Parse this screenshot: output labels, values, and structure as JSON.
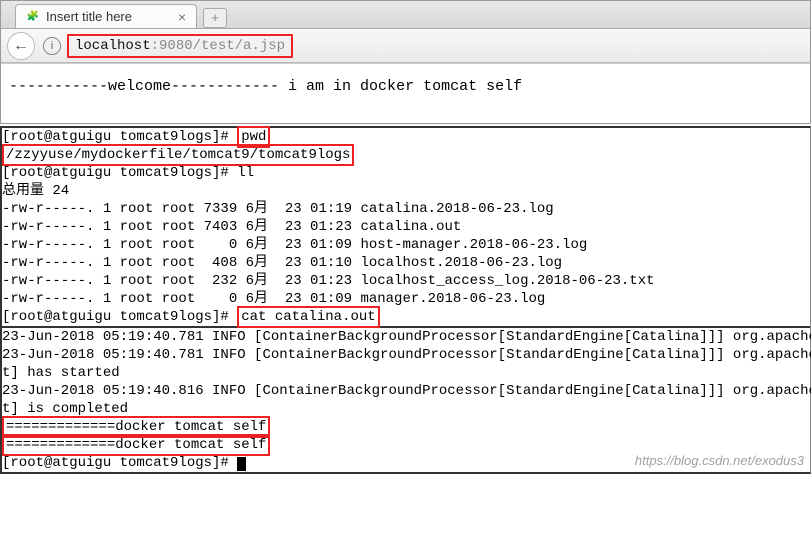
{
  "browser": {
    "tab_title": "Insert title here",
    "favicon_glyph": "🧩",
    "close_glyph": "×",
    "newtab_glyph": "+",
    "back_glyph": "←",
    "info_glyph": "i",
    "url_host": "localhost",
    "url_path": ":9080/test/a.jsp",
    "page_body": "-----------welcome------------ i am in docker tomcat self"
  },
  "terminal": {
    "prompt1": "[root@atguigu tomcat9logs]# ",
    "cmd_pwd": "pwd",
    "pwd_output": "/zzyyuse/mydockerfile/tomcat9/tomcat9logs",
    "prompt2": "[root@atguigu tomcat9logs]# ",
    "cmd_ll": "ll",
    "ll_header": "总用量 24",
    "ll_rows": [
      "-rw-r-----. 1 root root 7339 6月  23 01:19 catalina.2018-06-23.log",
      "-rw-r-----. 1 root root 7403 6月  23 01:23 catalina.out",
      "-rw-r-----. 1 root root    0 6月  23 01:09 host-manager.2018-06-23.log",
      "-rw-r-----. 1 root root  408 6月  23 01:10 localhost.2018-06-23.log",
      "-rw-r-----. 1 root root  232 6月  23 01:23 localhost_access_log.2018-06-23.txt",
      "-rw-r-----. 1 root root    0 6月  23 01:09 manager.2018-06-23.log"
    ],
    "prompt3": "[root@atguigu tomcat9logs]# ",
    "cmd_cat": "cat catalina.out",
    "cat_lines": [
      "23-Jun-2018 05:19:40.781 INFO [ContainerBackgroundProcessor[StandardEngine[Catalina]]] org.apache",
      "23-Jun-2018 05:19:40.781 INFO [ContainerBackgroundProcessor[StandardEngine[Catalina]]] org.apache",
      "t] has started",
      "23-Jun-2018 05:19:40.816 INFO [ContainerBackgroundProcessor[StandardEngine[Catalina]]] org.apache",
      "t] is completed"
    ],
    "echo1": "=============docker tomcat self",
    "echo2": "=============docker tomcat self",
    "prompt4": "[root@atguigu tomcat9logs]# "
  },
  "watermark": "https://blog.csdn.net/exodus3"
}
